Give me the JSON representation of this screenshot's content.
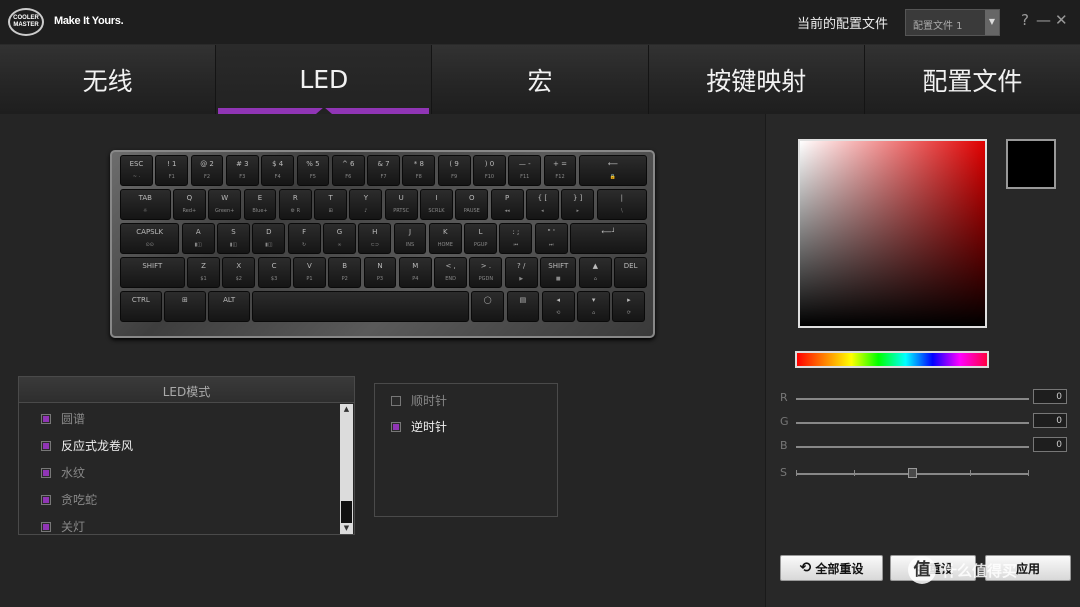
{
  "app": {
    "logo_line1": "COOLER",
    "logo_line2": "MASTER",
    "tagline": "Make It Yours."
  },
  "titlebar": {
    "profile_label": "当前的配置文件",
    "profile_value": "配置文件 1",
    "help": "?",
    "minimize": "—",
    "close": "✕"
  },
  "tabs": [
    {
      "label": "无线",
      "active": false
    },
    {
      "label": "LED",
      "active": true
    },
    {
      "label": "宏",
      "active": false
    },
    {
      "label": "按键映射",
      "active": false
    },
    {
      "label": "配置文件",
      "active": false
    }
  ],
  "keyboard": {
    "rows": [
      [
        [
          "ESC",
          "~ ·"
        ],
        [
          "! 1",
          "F1"
        ],
        [
          "@ 2",
          "F2"
        ],
        [
          "# 3",
          "F3"
        ],
        [
          "$ 4",
          "F4"
        ],
        [
          "% 5",
          "F5"
        ],
        [
          "^ 6",
          "F6"
        ],
        [
          "& 7",
          "F7"
        ],
        [
          "* 8",
          "F8"
        ],
        [
          "( 9",
          "F9"
        ],
        [
          ") 0",
          "F10"
        ],
        [
          "— -",
          "F11"
        ],
        [
          "+ =",
          "F12"
        ],
        [
          "⟵",
          "🔒"
        ]
      ],
      [
        [
          "TAB",
          "☼"
        ],
        [
          "Q",
          "Red+"
        ],
        [
          "W",
          "Green+"
        ],
        [
          "E",
          "Blue+"
        ],
        [
          "R",
          "⚙ R"
        ],
        [
          "T",
          "⊞"
        ],
        [
          "Y",
          "♪"
        ],
        [
          "U",
          "PRTSC"
        ],
        [
          "I",
          "SCRLK"
        ],
        [
          "O",
          "PAUSE"
        ],
        [
          "P",
          "◂◂"
        ],
        [
          "{ [",
          "◂"
        ],
        [
          "} ]",
          "▸"
        ],
        [
          "|",
          "\\"
        ]
      ],
      [
        [
          "CAPSLK",
          "⊙⊙"
        ],
        [
          "A",
          "▮◫"
        ],
        [
          "S",
          "▮◫"
        ],
        [
          "D",
          "▮◫"
        ],
        [
          "F",
          "↻"
        ],
        [
          "G",
          "∞"
        ],
        [
          "H",
          "⊂⊃"
        ],
        [
          "J",
          "INS"
        ],
        [
          "K",
          "HOME"
        ],
        [
          "L",
          "PGUP"
        ],
        [
          ": ;",
          "⏮"
        ],
        [
          "\" '",
          "⏭"
        ],
        [
          "⟵┘",
          ""
        ]
      ],
      [
        [
          "SHIFT",
          ""
        ],
        [
          "Z",
          "$1"
        ],
        [
          "X",
          "$2"
        ],
        [
          "C",
          "$3"
        ],
        [
          "V",
          "P1"
        ],
        [
          "B",
          "P2"
        ],
        [
          "N",
          "P3"
        ],
        [
          "M",
          "P4"
        ],
        [
          "< ,",
          "END"
        ],
        [
          "> .",
          "PGDN"
        ],
        [
          "? /",
          "▶"
        ],
        [
          "SHIFT",
          "■"
        ],
        [
          "▲",
          "⌂"
        ],
        [
          "DEL",
          ""
        ]
      ],
      [
        [
          "CTRL",
          ""
        ],
        [
          "⊞",
          ""
        ],
        [
          "ALT",
          ""
        ],
        [
          "",
          ""
        ],
        [
          "◯",
          ""
        ],
        [
          "▤",
          ""
        ],
        [
          "◂",
          "⟲"
        ],
        [
          "▾",
          "⌂"
        ],
        [
          "▸",
          "⟳"
        ]
      ]
    ]
  },
  "led_modes": {
    "header": "LED模式",
    "items": [
      {
        "label": "圆谱",
        "checked": true,
        "selected": false
      },
      {
        "label": "反应式龙卷风",
        "checked": true,
        "selected": true
      },
      {
        "label": "水纹",
        "checked": true,
        "selected": false
      },
      {
        "label": "贪吃蛇",
        "checked": true,
        "selected": false
      },
      {
        "label": "关灯",
        "checked": true,
        "selected": false
      }
    ]
  },
  "direction": {
    "items": [
      {
        "label": "顺时针",
        "checked": false,
        "selected": false
      },
      {
        "label": "逆时针",
        "checked": true,
        "selected": true
      }
    ]
  },
  "color": {
    "current_swatch": "#000000",
    "accent": "#9035b5",
    "r_label": "R",
    "r_value": "0",
    "g_label": "G",
    "g_value": "0",
    "b_label": "B",
    "b_value": "0",
    "s_label": "S"
  },
  "buttons": {
    "reset_all": "全部重设",
    "reset": "重设",
    "apply": "应用"
  },
  "watermark": {
    "icon": "值",
    "text": "什么值得买"
  }
}
